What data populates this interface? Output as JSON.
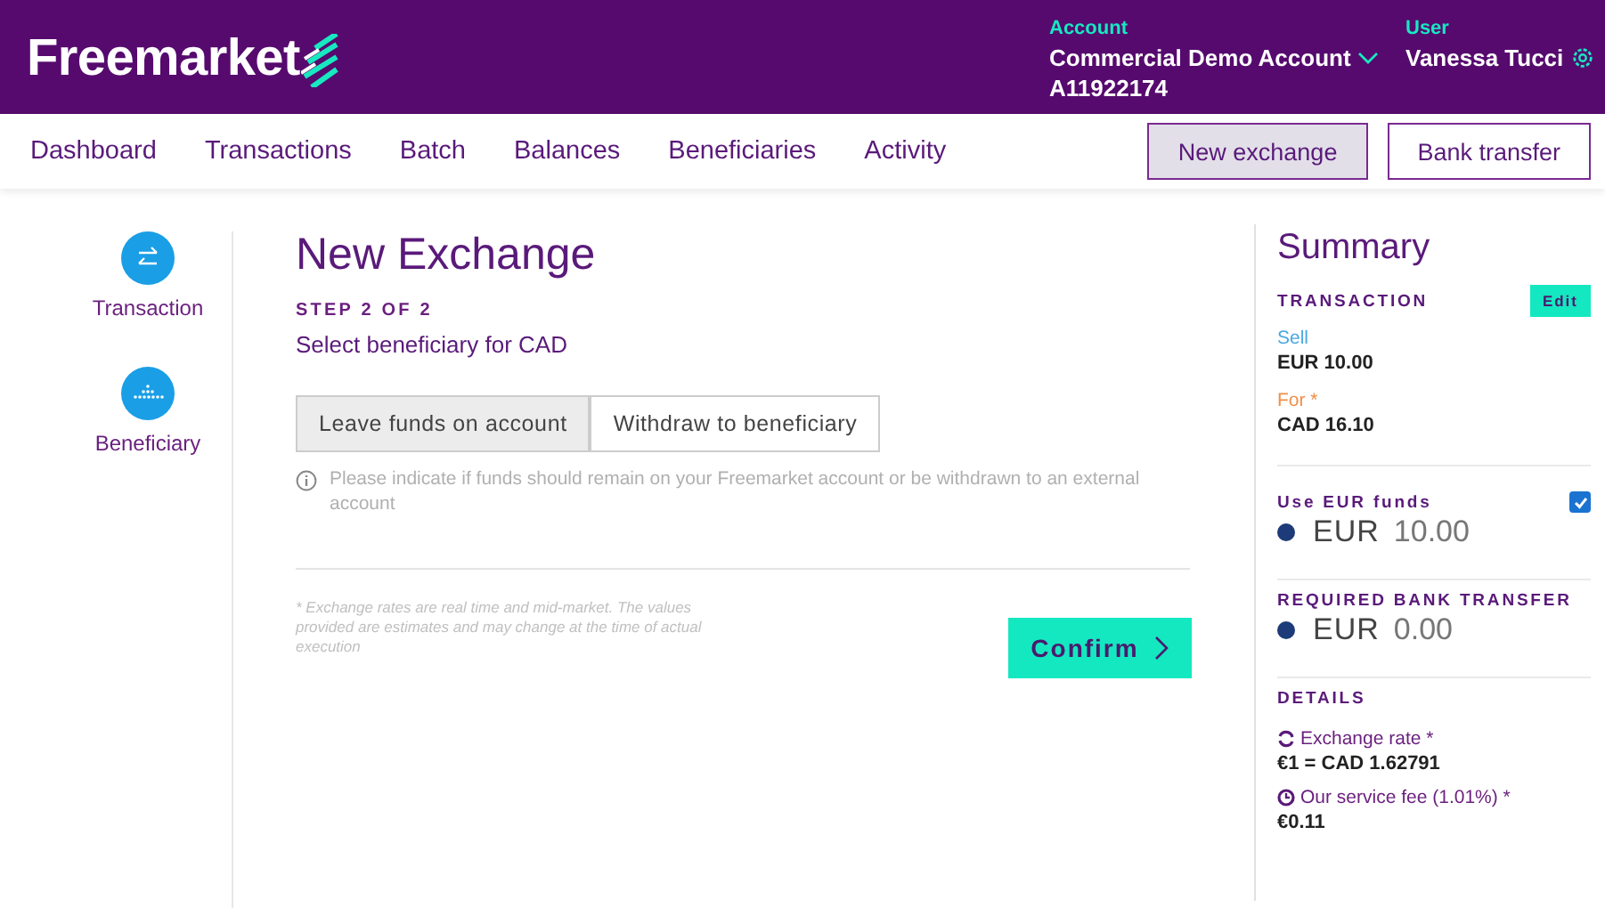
{
  "header": {
    "logo": "Freemarket",
    "account_label": "Account",
    "account_name": "Commercial Demo Account",
    "account_id": "A11922174",
    "user_label": "User",
    "user_name": "Vanessa Tucci"
  },
  "nav": {
    "items": [
      {
        "label": "Dashboard"
      },
      {
        "label": "Transactions"
      },
      {
        "label": "Batch"
      },
      {
        "label": "Balances"
      },
      {
        "label": "Beneficiaries"
      },
      {
        "label": "Activity"
      }
    ],
    "actions": [
      {
        "label": "New exchange",
        "selected": true
      },
      {
        "label": "Bank transfer",
        "selected": false
      }
    ]
  },
  "steps": [
    {
      "label": "Transaction",
      "kind": "exchange"
    },
    {
      "label": "Beneficiary",
      "kind": "beneficiary"
    }
  ],
  "main": {
    "title": "New Exchange",
    "step": "STEP 2 OF 2",
    "subtitle": "Select beneficiary for CAD",
    "options": [
      {
        "label": "Leave funds on account",
        "selected": true
      },
      {
        "label": "Withdraw to beneficiary",
        "selected": false
      }
    ],
    "info": "Please indicate if funds should remain on your Freemarket account or be withdrawn to an external account",
    "disclaimer": "* Exchange rates are real time and mid-market. The values provided are estimates and may change at the time of actual execution",
    "confirm": "Confirm"
  },
  "summary": {
    "title": "Summary",
    "transaction_heading": "TRANSACTION",
    "edit": "Edit",
    "sell_label": "Sell",
    "sell_value": "EUR 10.00",
    "for_label": "For *",
    "for_value": "CAD 16.10",
    "use_funds": {
      "label": "Use EUR funds",
      "checked": true,
      "currency": "EUR",
      "amount": "10.00"
    },
    "required": {
      "label": "REQUIRED BANK TRANSFER",
      "currency": "EUR",
      "amount": "0.00"
    },
    "details_heading": "DETAILS",
    "rate_label": "Exchange rate *",
    "rate_value": "€1 = CAD 1.62791",
    "fee_label": "Our service fee (1.01%) *",
    "fee_value": "€0.11"
  }
}
